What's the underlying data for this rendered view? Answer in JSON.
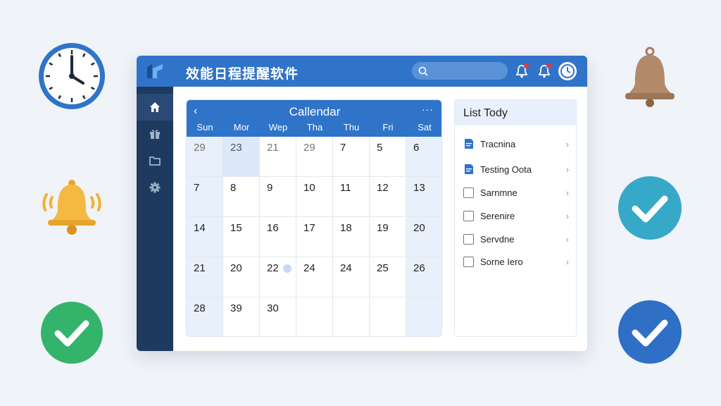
{
  "app": {
    "title": "效能日程提醒软件",
    "accent": "#2f74c9",
    "sidebar_color": "#1e3a5f"
  },
  "sidebar": {
    "items": [
      {
        "icon": "home-icon"
      },
      {
        "icon": "gift-icon"
      },
      {
        "icon": "folder-icon"
      },
      {
        "icon": "gear-icon"
      }
    ]
  },
  "topbar": {
    "search_icon": "search-icon",
    "notification_icons": [
      "bell-icon",
      "bell-icon"
    ],
    "clock_icon": "clock-icon"
  },
  "calendar": {
    "title": "Callendar",
    "prev": "‹",
    "more": "···",
    "weekdays": [
      "Sun",
      "Mor",
      "Wep",
      "Tha",
      "Thu",
      "Fri",
      "Sat"
    ],
    "weeks": [
      [
        "29",
        "23",
        "21",
        "29",
        "7",
        "5",
        "6"
      ],
      [
        "7",
        "8",
        "9",
        "10",
        "11",
        "12",
        "13"
      ],
      [
        "14",
        "15",
        "16",
        "17",
        "18",
        "19",
        "20"
      ],
      [
        "21",
        "20",
        "22",
        "24",
        "24",
        "25",
        "26"
      ],
      [
        "28",
        "39",
        "30",
        "",
        "",
        "",
        ""
      ]
    ]
  },
  "list": {
    "title": "List Tody",
    "items": [
      {
        "label": "Tracnina",
        "icon": "document-icon"
      },
      {
        "label": "Testing Oota",
        "icon": "document-icon"
      },
      {
        "label": "Sarnmne",
        "icon": "checkbox"
      },
      {
        "label": "Serenire",
        "icon": "checkbox"
      },
      {
        "label": "Servdne",
        "icon": "checkbox"
      },
      {
        "label": "Sorne Iero",
        "icon": "checkbox"
      }
    ],
    "chevron": "›"
  },
  "decorations": [
    "clock-icon",
    "bell-icon",
    "check-icon",
    "bell-icon",
    "check-icon",
    "check-icon"
  ]
}
